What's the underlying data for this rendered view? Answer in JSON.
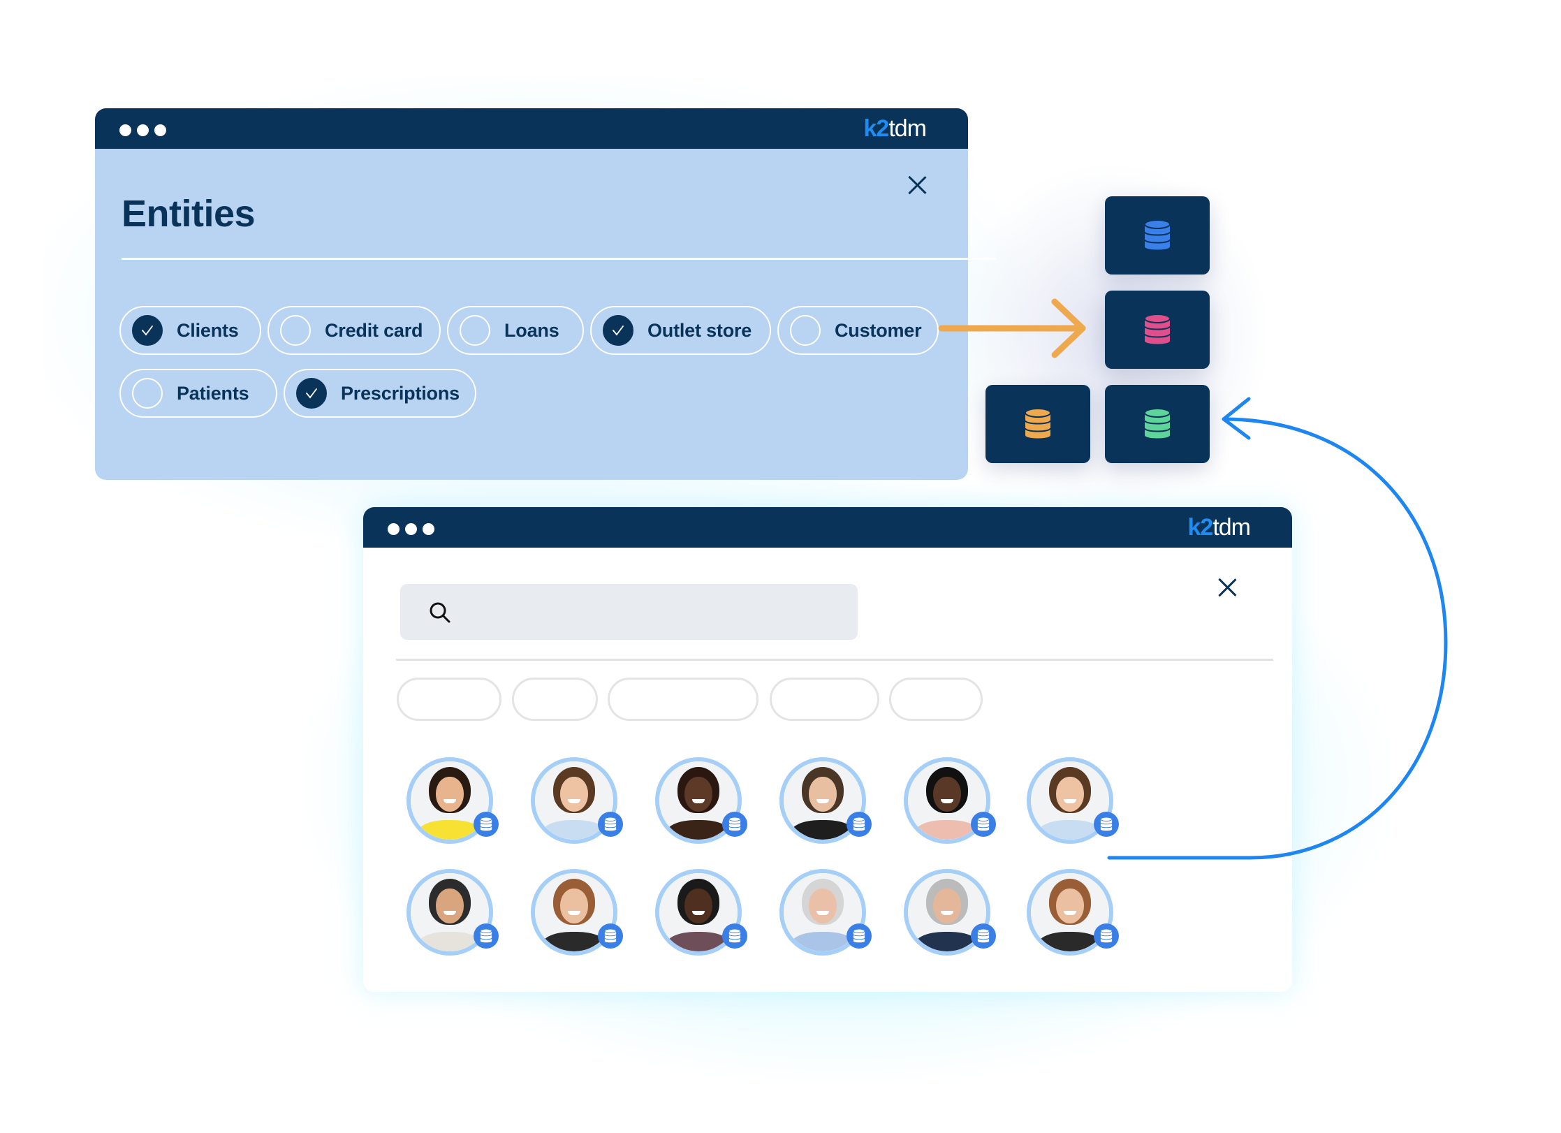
{
  "brand": {
    "logo_prefix": "k2",
    "logo_suffix": "tdm",
    "navy": "#0A335A",
    "accent_blue": "#1E8CF0"
  },
  "entities_window": {
    "title": "Entities",
    "chips": [
      {
        "label": "Clients",
        "checked": true
      },
      {
        "label": "Credit card",
        "checked": false
      },
      {
        "label": "Loans",
        "checked": false
      },
      {
        "label": "Outlet store",
        "checked": true
      },
      {
        "label": "Customer",
        "checked": false
      },
      {
        "label": "Patients",
        "checked": false
      },
      {
        "label": "Prescriptions",
        "checked": true
      }
    ]
  },
  "database_tiles": [
    {
      "icon": "database-icon",
      "color": "#3A80E8"
    },
    {
      "icon": "database-icon",
      "color": "#E04E8C"
    },
    {
      "icon": "database-icon",
      "color": "#EEA94F"
    },
    {
      "icon": "database-icon",
      "color": "#5ED39A"
    }
  ],
  "arrows": {
    "entities_to_db": {
      "color": "#EEA94F"
    },
    "results_to_db": {
      "color": "#1E86F0"
    }
  },
  "search_window": {
    "search": {
      "value": "",
      "placeholder": ""
    },
    "filter_chip_count": 5,
    "avatars_row1": [
      {
        "skin": "#E8B48E",
        "hair": "#2A1B12",
        "shirt": "#F7E233"
      },
      {
        "skin": "#EDC3A4",
        "hair": "#5A3A22",
        "shirt": "#C9DDF2"
      },
      {
        "skin": "#5C3A27",
        "hair": "#2A1710",
        "shirt": "#3A2418"
      },
      {
        "skin": "#E9BFA2",
        "hair": "#4A3626",
        "shirt": "#1E1E1E"
      },
      {
        "skin": "#5A3828",
        "hair": "#111111",
        "shirt": "#EDBDB0"
      },
      {
        "skin": "#EDC3A4",
        "hair": "#5A3A22",
        "shirt": "#C9DDF2"
      }
    ],
    "avatars_row2": [
      {
        "skin": "#D9A57F",
        "hair": "#2C2C2C",
        "shirt": "#E6E3DC"
      },
      {
        "skin": "#EBC0A0",
        "hair": "#9A5E36",
        "shirt": "#2A2A2A"
      },
      {
        "skin": "#4E2F20",
        "hair": "#1A1A1A",
        "shirt": "#6E4E58"
      },
      {
        "skin": "#EAC1A8",
        "hair": "#D5D5D5",
        "shirt": "#A9C4E6"
      },
      {
        "skin": "#E4B79A",
        "hair": "#BBBBBB",
        "shirt": "#22334F"
      },
      {
        "skin": "#EBC0A0",
        "hair": "#9A5E36",
        "shirt": "#2A2A2A"
      }
    ],
    "avatar_badge_icon": "database-icon"
  }
}
